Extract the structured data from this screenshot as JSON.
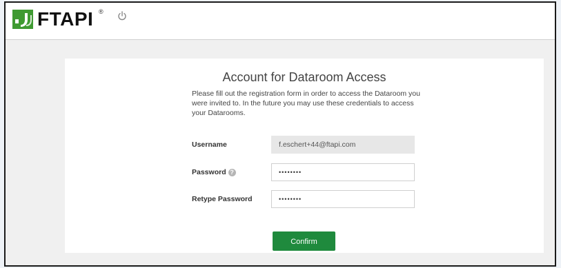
{
  "header": {
    "brand": "FTAPI",
    "registered": "®",
    "logo_icon": "ftapi-logo-icon",
    "power_icon": "power-icon"
  },
  "form": {
    "title": "Account for Dataroom Access",
    "description": "Please fill out the registration form in order to access the Dataroom you were invited to. In the future you may use these credentials to access your Datarooms.",
    "fields": [
      {
        "label": "Username",
        "value": "f.eschert+44@ftapi.com",
        "readonly": true
      },
      {
        "label": "Password",
        "value": "••••••••",
        "help_icon": "question-mark-icon"
      },
      {
        "label": "Retype Password",
        "value": "••••••••"
      }
    ],
    "confirm_label": "Confirm"
  },
  "colors": {
    "accent_green": "#1f8a3d",
    "background": "#f0f0f0"
  }
}
